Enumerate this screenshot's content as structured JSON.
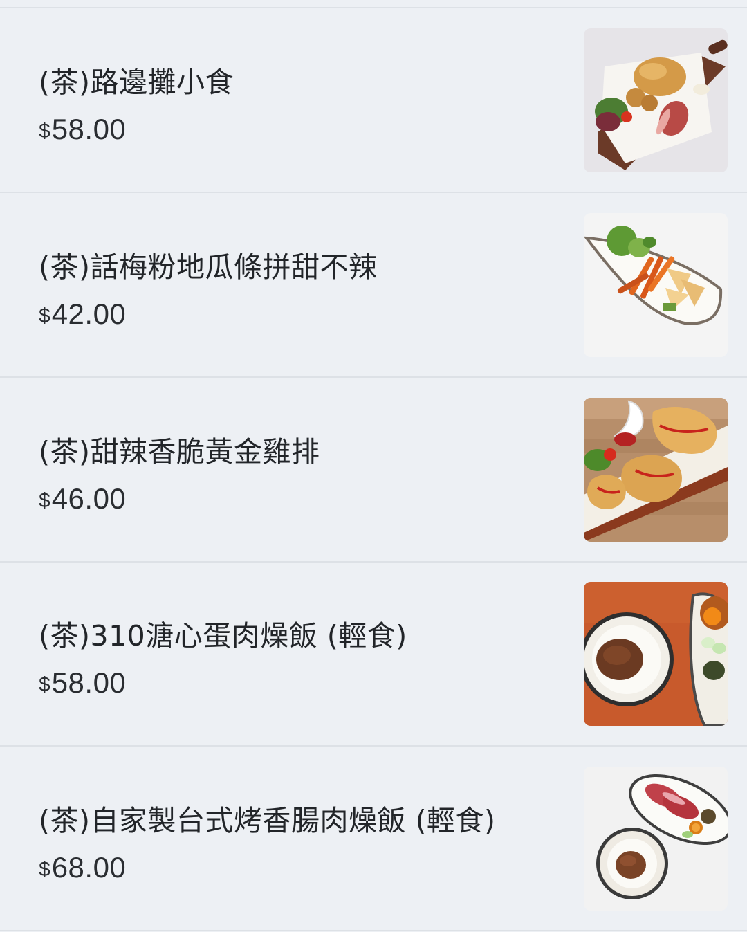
{
  "menu": {
    "items": [
      {
        "name": "(茶)路邊攤小食",
        "currency": "$",
        "price": "58.00",
        "image": "street-snack-platter-photo"
      },
      {
        "name": "(茶)話梅粉地瓜條拼甜不辣",
        "currency": "$",
        "price": "42.00",
        "image": "sweet-potato-fries-tempura-photo"
      },
      {
        "name": "(茶)甜辣香脆黃金雞排",
        "currency": "$",
        "price": "46.00",
        "image": "fried-chicken-cutlet-photo"
      },
      {
        "name": "(茶)310溏心蛋肉燥飯 (輕食)",
        "currency": "$",
        "price": "58.00",
        "image": "braised-pork-rice-egg-photo"
      },
      {
        "name": "(茶)自家製台式烤香腸肉燥飯 (輕食)",
        "currency": "$",
        "price": "68.00",
        "image": "sausage-pork-rice-photo"
      }
    ]
  }
}
